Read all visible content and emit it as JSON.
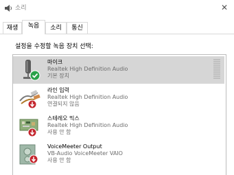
{
  "window": {
    "title": "소리",
    "close_glyph": "✕"
  },
  "tabs": [
    {
      "label": "재생",
      "active": false
    },
    {
      "label": "녹음",
      "active": true
    },
    {
      "label": "소리",
      "active": false
    },
    {
      "label": "통신",
      "active": false
    }
  ],
  "instruction": "설정을 수정할 녹음 장치 선택:",
  "devices": [
    {
      "name": "마이크",
      "driver": "Realtek High Definition Audio",
      "status": "기본 장치",
      "icon": "microphone-icon",
      "badge": "check",
      "selected": true
    },
    {
      "name": "라인 입력",
      "driver": "Realtek High Definition Audio",
      "status": "연결되지 않음",
      "icon": "line-in-cable-icon",
      "badge": "down-arrow",
      "selected": false
    },
    {
      "name": "스테레오 믹스",
      "driver": "Realtek High Definition Audio",
      "status": "사용 안 함",
      "icon": "circuit-board-icon",
      "badge": "down-arrow",
      "selected": false
    },
    {
      "name": "VoiceMeeter Output",
      "driver": "VB-Audio VoiceMeeter VAIO",
      "status": "사용 안 함",
      "icon": "speaker-device-icon",
      "badge": "down-arrow",
      "selected": false
    }
  ],
  "colors": {
    "selected_row": "#d6d6d6",
    "default_badge": "#2aa14a",
    "disabled_badge": "#c4262e"
  }
}
